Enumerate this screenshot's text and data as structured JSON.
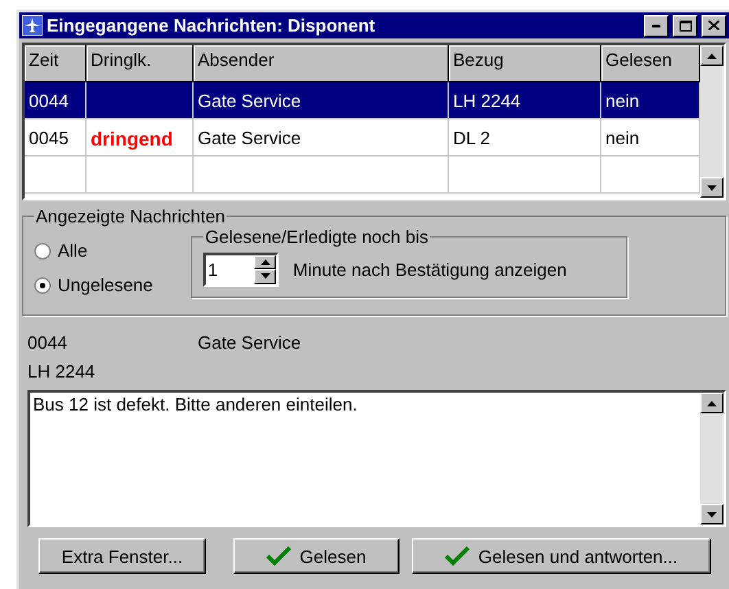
{
  "window": {
    "title": "Eingegangene Nachrichten: Disponent"
  },
  "table": {
    "columns": [
      "Zeit",
      "Dringlk.",
      "Absender",
      "Bezug",
      "Gelesen"
    ],
    "rows": [
      {
        "selected": true,
        "cells": [
          "0044",
          "",
          "Gate Service",
          "LH 2244",
          "nein"
        ]
      },
      {
        "selected": false,
        "urgent": true,
        "cells": [
          "0045",
          "dringend",
          "Gate Service",
          "DL 2",
          "nein"
        ]
      }
    ]
  },
  "filter": {
    "title": "Angezeigte Nachrichten",
    "options": [
      {
        "label": "Alle",
        "selected": false
      },
      {
        "label": "Ungelesene",
        "selected": true
      }
    ],
    "keep": {
      "title": "Gelesene/Erledigte noch bis",
      "value": "1",
      "label": "Minute nach Bestätigung anzeigen"
    }
  },
  "detail": {
    "time": "0044",
    "sender": "Gate Service",
    "reference": "LH 2244",
    "message": "Bus 12 ist defekt. Bitte anderen einteilen."
  },
  "buttons": [
    {
      "label": "Extra Fenster...",
      "check": false
    },
    {
      "label": "Gelesen",
      "check": true
    },
    {
      "label": "Gelesen und antworten...",
      "check": true
    }
  ]
}
